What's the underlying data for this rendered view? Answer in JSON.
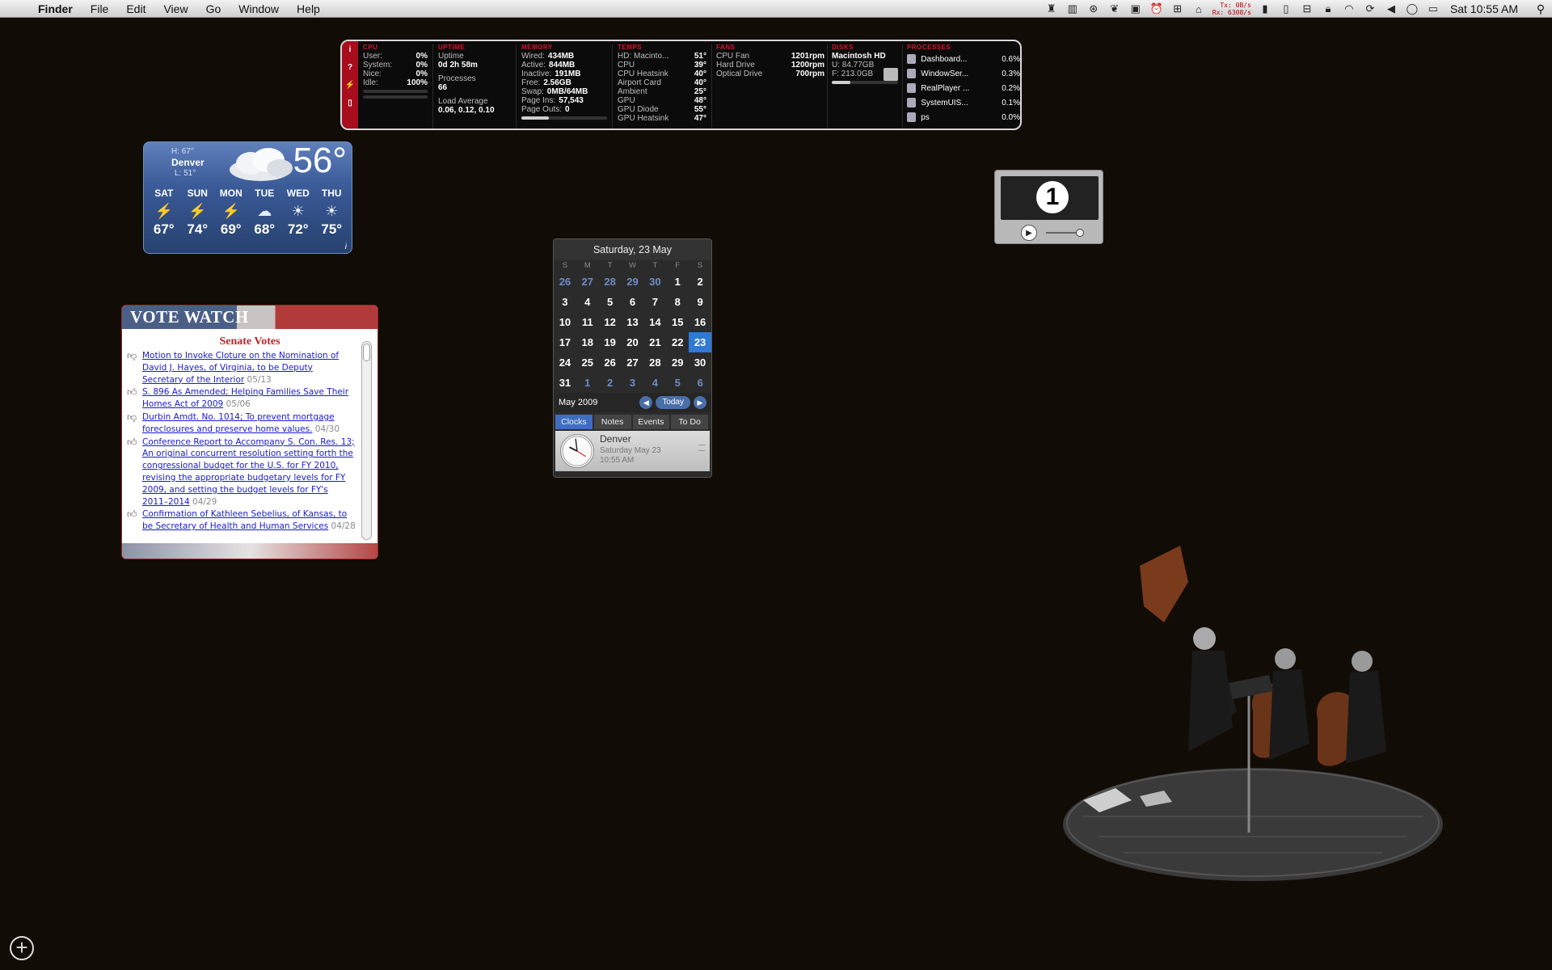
{
  "menubar": {
    "app": "Finder",
    "menus": [
      "File",
      "Edit",
      "View",
      "Go",
      "Window",
      "Help"
    ],
    "net_tx_label": "Tx:",
    "net_tx": "0B/s",
    "net_rx_label": "Rx:",
    "net_rx": "6308/s",
    "clock": "Sat 10:55 AM"
  },
  "istat": {
    "cpu": {
      "header": "CPU",
      "rows": [
        [
          "User:",
          "0%"
        ],
        [
          "System:",
          "0%"
        ],
        [
          "Nice:",
          "0%"
        ],
        [
          "Idle:",
          "100%"
        ]
      ],
      "usage_fraction": 0.0
    },
    "uptime": {
      "header": "UPTIME",
      "label": "Uptime",
      "value": "0d 2h 58m",
      "proc_label": "Processes",
      "proc_value": "66",
      "load_label": "Load Average",
      "load_value": "0.06, 0.12, 0.10"
    },
    "memory": {
      "header": "MEMORY",
      "rows": [
        [
          "Wired:",
          "434MB"
        ],
        [
          "Active:",
          "844MB"
        ],
        [
          "Inactive:",
          "191MB"
        ],
        [
          "Free:",
          "2.56GB"
        ],
        [
          "Swap:",
          "0MB/64MB"
        ],
        [
          "Page Ins:",
          "57,543"
        ],
        [
          "Page Outs:",
          "0"
        ]
      ],
      "usage_fraction": 0.32
    },
    "temps": {
      "header": "TEMPS",
      "rows": [
        [
          "HD: Macinto...",
          "51°"
        ],
        [
          "CPU",
          "39°"
        ],
        [
          "CPU Heatsink",
          "40°"
        ],
        [
          "Airport Card",
          "40°"
        ],
        [
          "Ambient",
          "25°"
        ],
        [
          "GPU",
          "48°"
        ],
        [
          "GPU Diode",
          "55°"
        ],
        [
          "GPU Heatsink",
          "47°"
        ]
      ]
    },
    "fans": {
      "header": "FANS",
      "rows": [
        [
          "CPU Fan",
          "1201rpm"
        ],
        [
          "Hard Drive",
          "1200rpm"
        ],
        [
          "Optical Drive",
          "700rpm"
        ]
      ]
    },
    "disks": {
      "header": "DISKS",
      "name": "Macintosh HD",
      "used": "U: 84.77GB",
      "free": "F: 213.0GB",
      "usage_fraction": 0.28
    },
    "processes": {
      "header": "PROCESSES",
      "rows": [
        [
          "Dashboard...",
          "0.6%"
        ],
        [
          "WindowSer...",
          "0.3%"
        ],
        [
          "RealPlayer ...",
          "0.2%"
        ],
        [
          "SystemUIS...",
          "0.1%"
        ],
        [
          "ps",
          "0.0%"
        ]
      ]
    },
    "side_icons": [
      "i",
      "?",
      "pulse-icon",
      "battery-icon"
    ]
  },
  "weather": {
    "hi": "H: 67°",
    "city": "Denver",
    "lo": "L: 51°",
    "temp": "56°",
    "days": [
      {
        "name": "SAT",
        "icon": "lightning-icon",
        "glyph": "⚡",
        "temp": "67°"
      },
      {
        "name": "SUN",
        "icon": "lightning-icon",
        "glyph": "⚡",
        "temp": "74°"
      },
      {
        "name": "MON",
        "icon": "lightning-icon",
        "glyph": "⚡",
        "temp": "69°"
      },
      {
        "name": "TUE",
        "icon": "cloud-icon",
        "glyph": "☁",
        "temp": "68°"
      },
      {
        "name": "WED",
        "icon": "sun-icon",
        "glyph": "☀",
        "temp": "72°"
      },
      {
        "name": "THU",
        "icon": "sun-icon",
        "glyph": "☀",
        "temp": "75°"
      }
    ],
    "info": "i"
  },
  "vote": {
    "header": "VOTE WATCH",
    "title": "Senate Votes",
    "items": [
      {
        "vote": "no",
        "text": "Motion to Invoke Cloture on the Nomination of David J. Hayes, of Virginia, to be Deputy Secretary of the Interior",
        "date": "05/13"
      },
      {
        "vote": "yes",
        "text": "S. 896 As Amended; Helping Families Save Their Homes Act of 2009",
        "date": "05/06"
      },
      {
        "vote": "no",
        "text": "Durbin Amdt. No. 1014; To prevent mortgage foreclosures and preserve home values.",
        "date": "04/30"
      },
      {
        "vote": "yes",
        "text": "Conference Report to Accompany S. Con. Res. 13; An original concurrent resolution setting forth the congressional budget for the U.S. for FY 2010, revising the appropriate budgetary levels for FY 2009, and setting the budget levels for FY's 2011–2014",
        "date": "04/29"
      },
      {
        "vote": "yes",
        "text": "Confirmation of Kathleen Sebelius, of Kansas, to be Secretary of Health and Human Services",
        "date": "04/28"
      }
    ]
  },
  "calendar": {
    "header": "Saturday, 23 May",
    "dow": [
      "S",
      "M",
      "T",
      "W",
      "T",
      "F",
      "S"
    ],
    "days": [
      [
        "26",
        "out"
      ],
      [
        "27",
        "out"
      ],
      [
        "28",
        "out"
      ],
      [
        "29",
        "out"
      ],
      [
        "30",
        "out"
      ],
      [
        "1",
        ""
      ],
      [
        "2",
        ""
      ],
      [
        "3",
        ""
      ],
      [
        "4",
        ""
      ],
      [
        "5",
        ""
      ],
      [
        "6",
        ""
      ],
      [
        "7",
        ""
      ],
      [
        "8",
        ""
      ],
      [
        "9",
        ""
      ],
      [
        "10",
        ""
      ],
      [
        "11",
        ""
      ],
      [
        "12",
        ""
      ],
      [
        "13",
        ""
      ],
      [
        "14",
        ""
      ],
      [
        "15",
        ""
      ],
      [
        "16",
        ""
      ],
      [
        "17",
        ""
      ],
      [
        "18",
        ""
      ],
      [
        "19",
        ""
      ],
      [
        "20",
        ""
      ],
      [
        "21",
        ""
      ],
      [
        "22",
        ""
      ],
      [
        "23",
        "today"
      ],
      [
        "24",
        ""
      ],
      [
        "25",
        ""
      ],
      [
        "26",
        ""
      ],
      [
        "27",
        ""
      ],
      [
        "28",
        ""
      ],
      [
        "29",
        ""
      ],
      [
        "30",
        ""
      ],
      [
        "31",
        ""
      ],
      [
        "1",
        "out"
      ],
      [
        "2",
        "out"
      ],
      [
        "3",
        "out"
      ],
      [
        "4",
        "out"
      ],
      [
        "5",
        "out"
      ],
      [
        "6",
        "out"
      ]
    ],
    "month": "May 2009",
    "today_label": "Today",
    "tabs": [
      "Clocks",
      "Notes",
      "Events",
      "To Do"
    ],
    "clock_city": "Denver",
    "clock_date": "Saturday May 23",
    "clock_time": "10:55 AM"
  },
  "spaces": {
    "number": "1"
  }
}
